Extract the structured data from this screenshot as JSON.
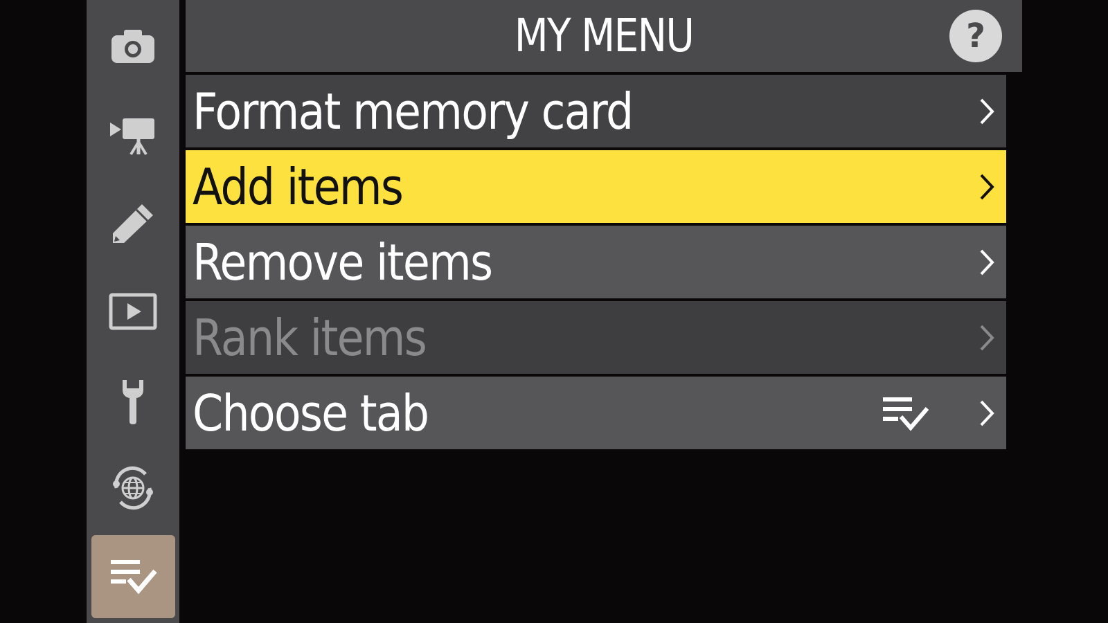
{
  "header": {
    "title": "MY MENU",
    "help_label": "?"
  },
  "sidebar": {
    "tabs": [
      {
        "icon": "camera-icon",
        "name": "photo-shooting-menu"
      },
      {
        "icon": "movie-camera-icon",
        "name": "movie-recording-menu"
      },
      {
        "icon": "pencil-icon",
        "name": "custom-settings-menu"
      },
      {
        "icon": "playback-icon",
        "name": "playback-menu"
      },
      {
        "icon": "wrench-icon",
        "name": "setup-menu"
      },
      {
        "icon": "network-globe-icon",
        "name": "network-menu"
      },
      {
        "icon": "my-menu-icon",
        "name": "my-menu",
        "active": true
      }
    ]
  },
  "menu": {
    "items": [
      {
        "label": "Format memory card",
        "state": "normal"
      },
      {
        "label": "Add items",
        "state": "selected"
      },
      {
        "label": "Remove items",
        "state": "normal"
      },
      {
        "label": "Rank items",
        "state": "disabled"
      },
      {
        "label": "Choose tab",
        "state": "normal",
        "extra_icon": "my-menu-icon"
      }
    ]
  },
  "colors": {
    "selected_row": "#fde23f",
    "row": "#565557",
    "row_alt": "#424143",
    "sidebar": "#4a494b",
    "active_tab": "#a99582",
    "background": "#0a0709"
  }
}
